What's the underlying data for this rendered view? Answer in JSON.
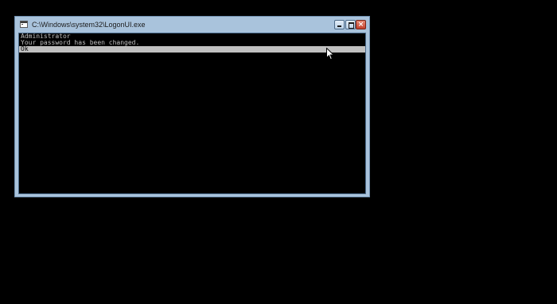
{
  "window": {
    "title": "C:\\Windows\\system32\\LogonUI.exe",
    "buttons": {
      "minimize": "minimize-icon",
      "maximize": "maximize-icon",
      "close": "×"
    }
  },
  "console": {
    "lines": [
      "Administrator",
      "Your password has been changed.",
      "Ok"
    ]
  },
  "colors": {
    "frame": "#a9c3dc",
    "console_background": "#000000",
    "console_text": "#c0c0c0",
    "selection_highlight": "#c0c0c0"
  }
}
